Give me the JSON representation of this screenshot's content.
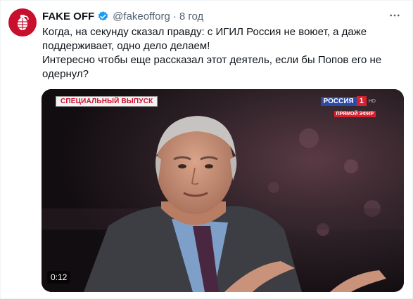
{
  "tweet": {
    "author_name": "FAKE OFF",
    "handle": "@fakeofforg",
    "separator": "·",
    "time": "8 год",
    "text_lines": [
      "Когда, на секунду сказал правду: с ИГИЛ Россия не воюет, а даже поддерживает, одно дело делаем!",
      "Интересно чтобы еще рассказал этот деятель, если бы Попов его не одернул?"
    ]
  },
  "media": {
    "banner": "СПЕЦИАЛЬНЫЙ ВЫПУСК",
    "channel_name": "РОССИЯ",
    "channel_number": "1",
    "channel_hd": "HD",
    "channel_live": "ПРЯМОЙ ЭФИР",
    "duration": "0:12"
  },
  "icons": {
    "avatar": "grenade-logo-icon",
    "verified": "verified-badge-icon",
    "more": "more-options-icon"
  },
  "colors": {
    "brand_red": "#c8102e",
    "verified_blue": "#1d9bf0",
    "secondary_text": "#536471"
  }
}
